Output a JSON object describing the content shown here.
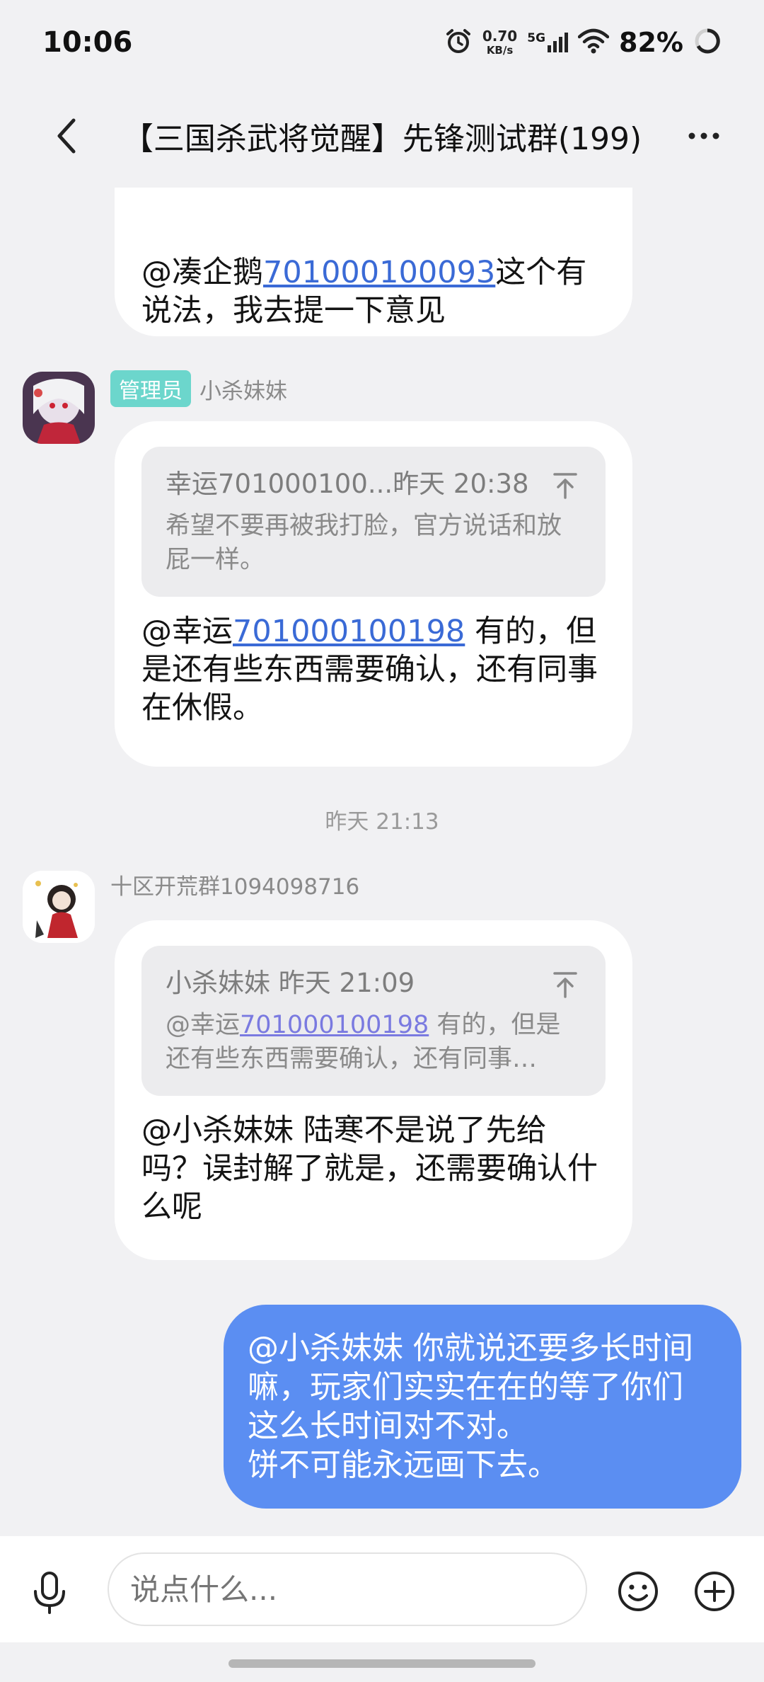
{
  "status_bar": {
    "time": "10:06",
    "net_speed_value": "0.70",
    "net_speed_unit": "KB/s",
    "network": "5G",
    "battery": "82%"
  },
  "header": {
    "title": "【三国杀武将觉醒】先锋测试群(199)"
  },
  "messages": [
    {
      "text_prefix": "@凑企鹅",
      "link": "701000100093",
      "text_suffix": "这个有说法，我去提一下意见"
    },
    {
      "sender_badge": "管理员",
      "sender_name": "小杀妹妹",
      "quote_head": "幸运701000100...昨天 20:38",
      "quote_body": "希望不要再被我打脸，官方说话和放屁一样。",
      "text_prefix": "@幸运",
      "link": "701000100198",
      "text_suffix": " 有的，但是还有些东西需要确认，还有同事在休假。"
    },
    {
      "time_divider": "昨天 21:13"
    },
    {
      "sender_name": "十区开荒群1094098716",
      "quote_head": "小杀妹妹 昨天 21:09",
      "quote_body_prefix": "@幸运",
      "quote_body_link": "701000100198",
      "quote_body_suffix": " 有的，但是还有些东西需要确认，还有同事…",
      "text": "@小杀妹妹 陆寒不是说了先给吗？误封解了就是，还需要确认什么呢"
    },
    {
      "mine": true,
      "text": "@小杀妹妹 你就说还要多长时间嘛，玩家们实实在在的等了你们这么长时间对不对。\n饼不可能永远画下去。"
    }
  ],
  "input_bar": {
    "placeholder": "说点什么..."
  },
  "colors": {
    "my_bubble": "#5b8ef2",
    "admin_badge": "#6cd6cc",
    "link": "#3a6ad6"
  }
}
